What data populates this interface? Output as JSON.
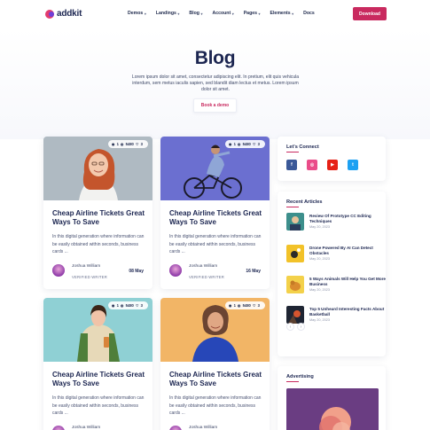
{
  "nav": {
    "logo": "addkit",
    "items": [
      {
        "label": "Demos",
        "caret": true
      },
      {
        "label": "Landings",
        "caret": true
      },
      {
        "label": "Blog",
        "caret": true
      },
      {
        "label": "Account",
        "caret": true
      },
      {
        "label": "Pages",
        "caret": true
      },
      {
        "label": "Elements",
        "caret": true
      },
      {
        "label": "Docs",
        "caret": false
      }
    ],
    "download_label": "Download"
  },
  "hero": {
    "title": "Blog",
    "text": "Lorem ipsum dolor sit amet, consectetur adipiscing elit. In pretium, elit quis vehicula interdum, sem metus iaculis sapien, sed blandit diam lectus et metus. Lorem ipsum dolor sit amet.",
    "button_label": "Book a demo"
  },
  "posts": [
    {
      "title": "Cheap Airline Tickets Great Ways To Save",
      "text": "In this digital generation where information can be easily obtained within seconds, business cards ...",
      "author": "Joshua William",
      "role": "VERIFIED WRITER",
      "date": "08 May",
      "stats": {
        "a": "1",
        "b": "5480",
        "c": "3"
      }
    },
    {
      "title": "Cheap Airline Tickets Great Ways To Save",
      "text": "In this digital generation where information can be easily obtained within seconds, business cards ...",
      "author": "Joshua William",
      "role": "VERIFIED WRITER",
      "date": "16 May",
      "stats": {
        "a": "1",
        "b": "5480",
        "c": "3"
      }
    },
    {
      "title": "Cheap Airline Tickets Great Ways To Save",
      "text": "In this digital generation where information can be easily obtained within seconds, business cards ...",
      "author": "Joshua William",
      "role": "",
      "date": "",
      "stats": {
        "a": "1",
        "b": "5480",
        "c": "3"
      }
    },
    {
      "title": "Cheap Airline Tickets Great Ways To Save",
      "text": "In this digital generation where information can be easily obtained within seconds, business cards ...",
      "author": "Joshua William",
      "role": "",
      "date": "",
      "stats": {
        "a": "1",
        "b": "5480",
        "c": "3"
      }
    }
  ],
  "sidebar": {
    "connect_title": "Let's Connect",
    "socials": [
      {
        "name": "facebook-icon",
        "glyph": "f",
        "color": "#3b5998"
      },
      {
        "name": "dribbble-icon",
        "glyph": "◎",
        "color": "#ea4c89"
      },
      {
        "name": "youtube-icon",
        "glyph": "▶",
        "color": "#e62117"
      },
      {
        "name": "twitter-icon",
        "glyph": "t",
        "color": "#1da1f2"
      }
    ],
    "recent_title": "Recent Articles",
    "articles": [
      {
        "title": "Review Of Prototype CC Editing Techniques",
        "date": "May 20, 2023"
      },
      {
        "title": "Drone Powered By AI Can Detect Obstacles",
        "date": "May 20, 2023"
      },
      {
        "title": "5 Ways Animals Will Help You Get More Business",
        "date": "May 20, 2023"
      },
      {
        "title": "Top 5 Unheard Interesting Facts About Basketball",
        "date": "May 20, 2023"
      }
    ],
    "pager_prev": "‹",
    "pager_next": "›",
    "advertising_title": "Advertising"
  },
  "colors": {
    "accent": "#c92a5f",
    "heading": "#1c2651"
  }
}
